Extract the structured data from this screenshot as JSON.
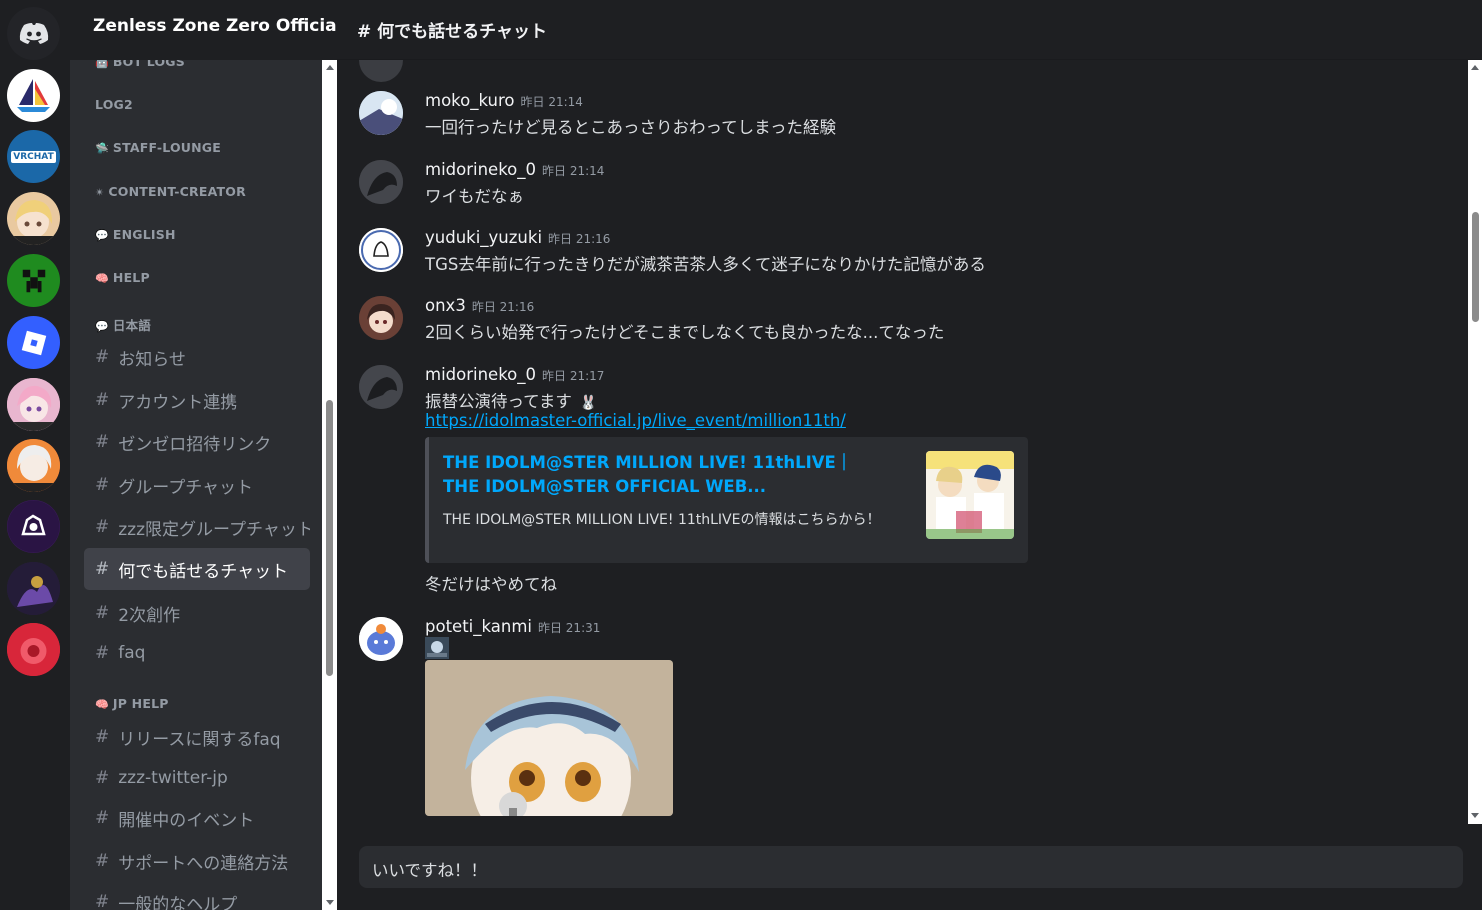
{
  "server": {
    "name": "Zenless Zone Zero Official"
  },
  "channel_header": {
    "title": "# 何でも話せるチャット"
  },
  "rail": {
    "servers": [
      {
        "name": "discord-home-icon",
        "color": "#232428"
      },
      {
        "name": "sailboat-server-icon",
        "color": "#ffffff"
      },
      {
        "name": "vrchat-server-icon",
        "color": "#1b68a8",
        "label": "VRCHAT"
      },
      {
        "name": "hoyoverse-character-server-icon",
        "color": "#e9c9a0"
      },
      {
        "name": "minecraft-creeper-server-icon",
        "color": "#1f8b1f"
      },
      {
        "name": "roblox-server-icon",
        "color": "#335fff"
      },
      {
        "name": "anime-girl-server-icon",
        "color": "#d7a3c0"
      },
      {
        "name": "hoyoverse-white-hair-server-icon",
        "color": "#e6622f"
      },
      {
        "name": "purple-logo-server-icon",
        "color": "#3a1b5a"
      },
      {
        "name": "dark-purple-art-server-icon",
        "color": "#2e2445"
      },
      {
        "name": "red-circle-server-icon",
        "color": "#d22a3a"
      }
    ]
  },
  "sidebar": {
    "categories": {
      "bot_logs": "BOT LOGS",
      "log2": "LOG2",
      "staff_lounge": "STAFF-LOUNGE",
      "content_creator": "CONTENT-CREATOR",
      "english": "ENGLISH",
      "help": "HELP",
      "japanese": "日本語",
      "jp_help": "JP HELP"
    },
    "channels": {
      "oshirase": "お知らせ",
      "account": "アカウント連携",
      "zenzero_invite": "ゼンゼロ招待リンク",
      "group_chat": "グループチャット",
      "zzz_group_chat": "zzz限定グループチャット",
      "anything_chat": "何でも話せるチャット",
      "fanart": "2次創作",
      "faq": "faq",
      "release_faq": "リリースに関するfaq",
      "twitter_jp": "zzz-twitter-jp",
      "events": "開催中のイベント",
      "support": "サポートへの連絡方法",
      "general_help": "一般的なヘルプ"
    },
    "hash": "#"
  },
  "messages": [
    {
      "author": "moko_kuro",
      "time": "昨日 21:14",
      "text": "一回行ったけど見るとこあっさりおわってしまった経験",
      "avatar_color": "#a8c6e8"
    },
    {
      "author": "midorineko_0",
      "time": "昨日 21:14",
      "text": "ワイもだなぁ",
      "avatar_color": "#3b3d42"
    },
    {
      "author": "yuduki_yuzuki",
      "time": "昨日 21:16",
      "text": "TGS去年前に行ったきりだが滅茶苦茶人多くて迷子になりかけた記憶がある",
      "avatar_color": "#ffffff"
    },
    {
      "author": "onx3",
      "time": "昨日 21:16",
      "text": "2回くらい始発で行ったけどそこまでしなくても良かったな...てなった",
      "avatar_color": "#5a3a34"
    },
    {
      "author": "midorineko_0",
      "time": "昨日 21:17",
      "text": "振替公演待ってます",
      "link": "https://idolmaster-official.jp/live_event/million11th/",
      "embed": {
        "title": "THE IDOLM@STER MILLION LIVE! 11thLIVE｜THE IDOLM@STER OFFICIAL WEB...",
        "description": "THE IDOLM@STER MILLION LIVE! 11thLIVEの情報はこちらから！"
      },
      "after_text": "冬だけはやめてね",
      "avatar_color": "#3b3d42"
    },
    {
      "author": "poteti_kanmi",
      "time": "昨日 21:31",
      "avatar_color": "#ffffff"
    }
  ],
  "composer": {
    "value": "いいですね！！"
  }
}
